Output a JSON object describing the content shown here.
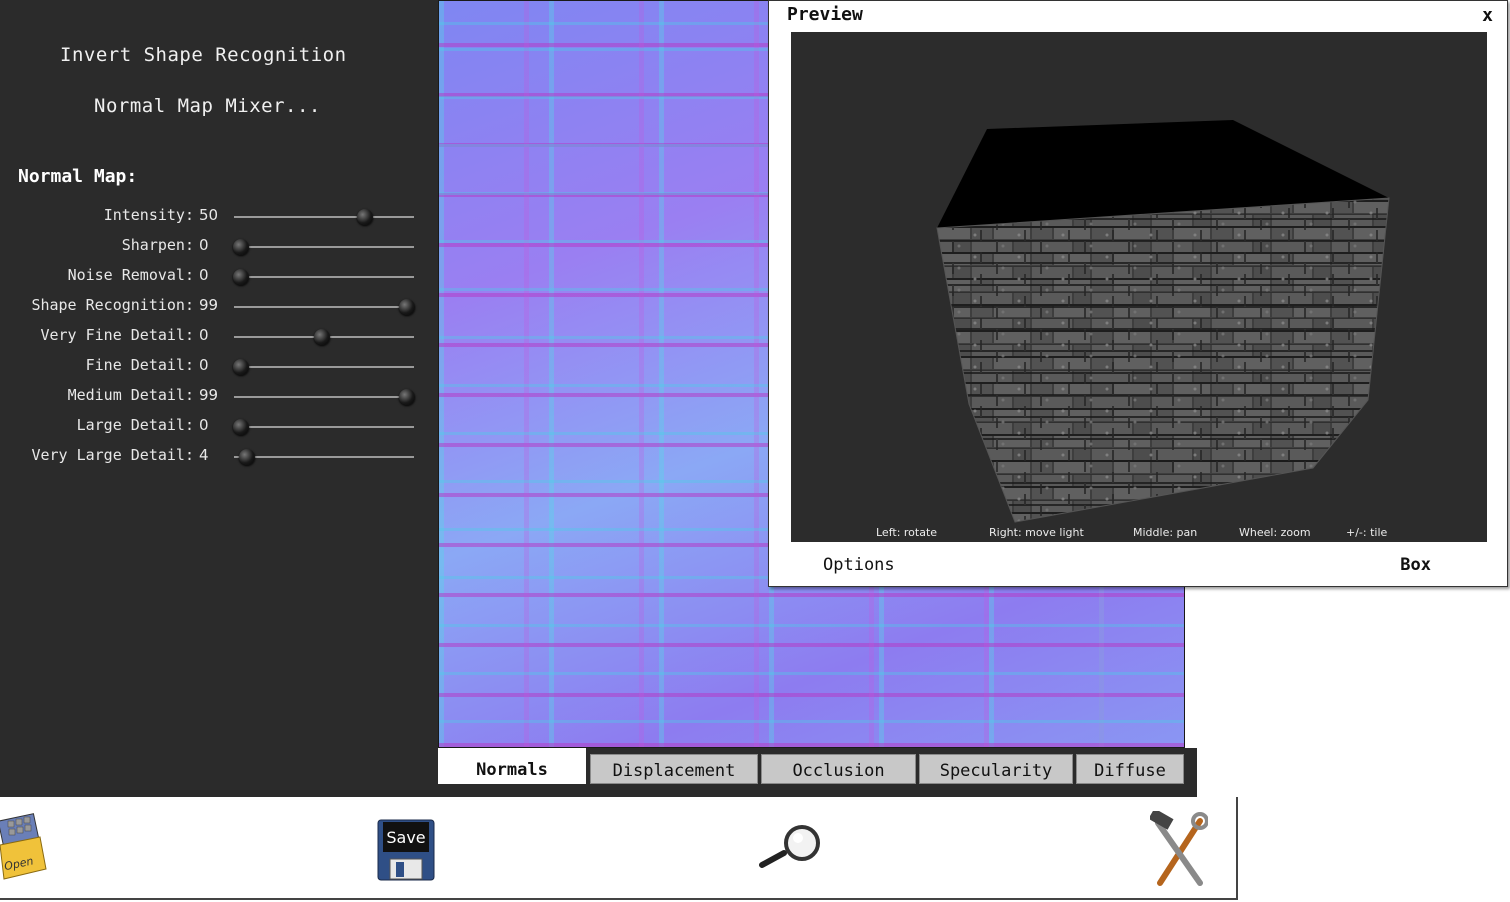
{
  "left_panel": {
    "menu": {
      "invert": "Invert Shape Recognition",
      "mixer": "Normal Map Mixer..."
    },
    "section_title": "Normal Map:",
    "sliders": [
      {
        "label": "Intensity:",
        "value": "50",
        "fraction": 0.73
      },
      {
        "label": "Sharpen:",
        "value": "0",
        "fraction": 0.04
      },
      {
        "label": "Noise Removal:",
        "value": "0",
        "fraction": 0.04
      },
      {
        "label": "Shape Recognition:",
        "value": "99",
        "fraction": 0.96
      },
      {
        "label": "Very Fine Detail:",
        "value": "0",
        "fraction": 0.49
      },
      {
        "label": "Fine Detail:",
        "value": "0",
        "fraction": 0.04
      },
      {
        "label": "Medium Detail:",
        "value": "99",
        "fraction": 0.96
      },
      {
        "label": "Large Detail:",
        "value": "0",
        "fraction": 0.04
      },
      {
        "label": "Very Large Detail:",
        "value": "4",
        "fraction": 0.07
      }
    ]
  },
  "tabs": [
    {
      "label": "Normals",
      "active": true
    },
    {
      "label": "Displacement",
      "active": false
    },
    {
      "label": "Occlusion",
      "active": false
    },
    {
      "label": "Specularity",
      "active": false
    },
    {
      "label": "Diffuse",
      "active": false
    }
  ],
  "toolbar": {
    "open_label": "Open",
    "save_label": "Save",
    "open_icon": "open-folder-icon",
    "save_icon": "floppy-disk-icon",
    "zoom_icon": "magnifier-icon",
    "tools_icon": "hammer-wrench-icon"
  },
  "preview": {
    "title": "Preview",
    "close": "x",
    "hints": {
      "left": "Left: rotate",
      "right": "Right: move light",
      "middle": "Middle: pan",
      "wheel": "Wheel: zoom",
      "tile": "+/-: tile"
    },
    "options_label": "Options",
    "shape_label": "Box"
  }
}
